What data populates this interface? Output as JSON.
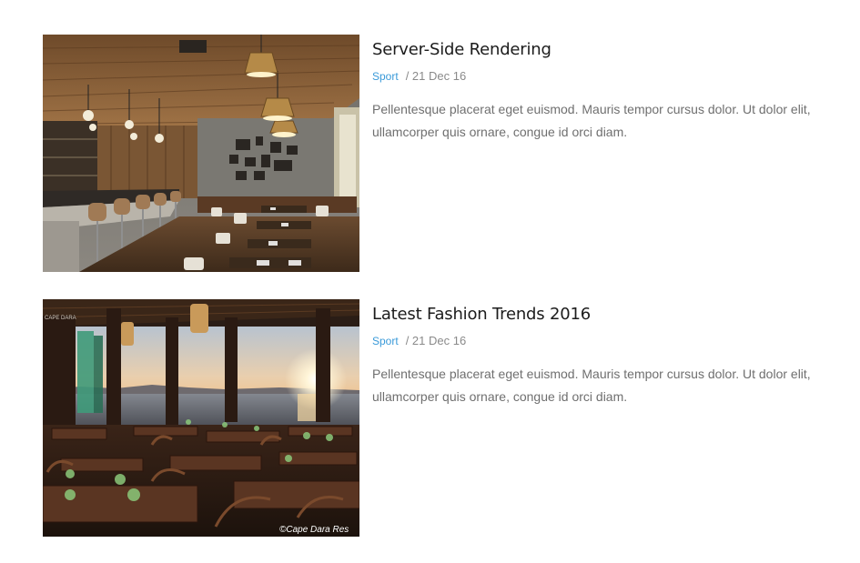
{
  "posts": [
    {
      "title": "Server-Side Rendering",
      "category": "Sport",
      "date": "21 Dec 16",
      "excerpt": "Pellentesque placerat eget euismod. Mauris tempor cursus dolor. Ut dolor elit, ullamcorper quis ornare, congue id orci diam.",
      "image": "restaurant-interior-photo"
    },
    {
      "title": "Latest Fashion Trends 2016",
      "category": "Sport",
      "date": "21 Dec 16",
      "excerpt": "Pellentesque placerat eget euismod. Mauris tempor cursus dolor. Ut dolor elit, ullamcorper quis ornare, congue id orci diam.",
      "image": "seaside-restaurant-photo",
      "image_watermark": "©Cape Dara Res",
      "image_sign": "CAPE DARA"
    }
  ]
}
